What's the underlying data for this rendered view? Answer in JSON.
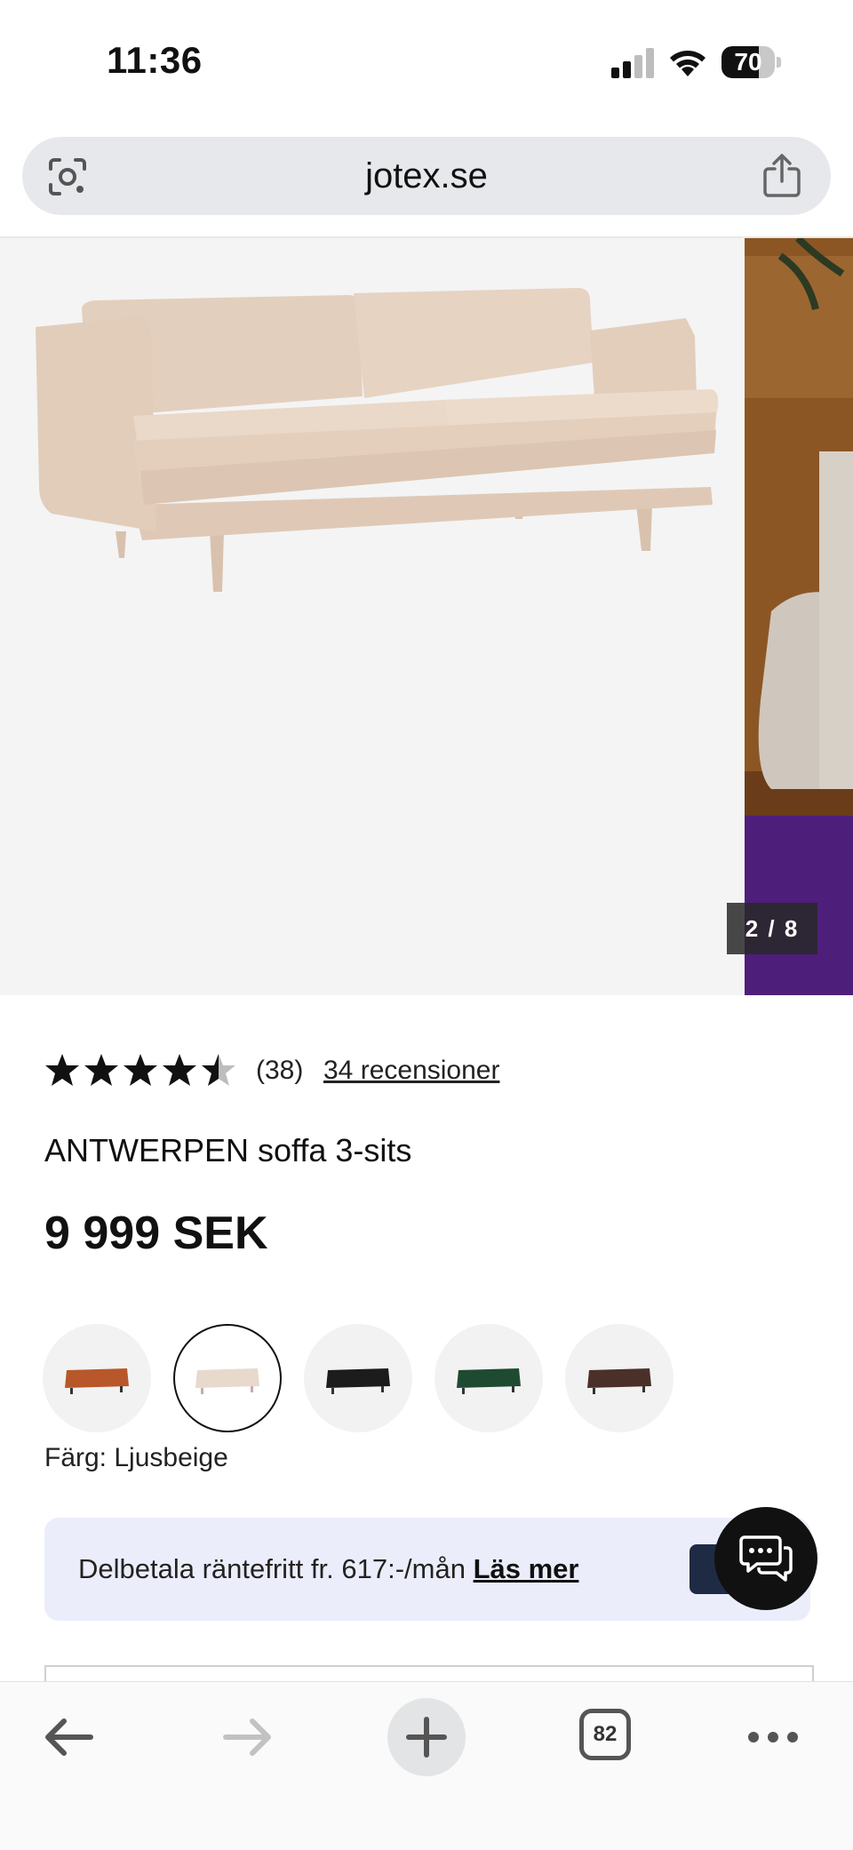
{
  "status_bar": {
    "time": "11:36",
    "battery": "70",
    "battery_level": 0.7,
    "icons": [
      "signal-icon",
      "wifi-icon",
      "battery-icon"
    ]
  },
  "address_bar": {
    "url": "jotex.se",
    "icons": [
      "lens-icon",
      "share-icon"
    ]
  },
  "gallery": {
    "counter": "2 / 8"
  },
  "product": {
    "rating_value": 4.5,
    "rating_count": "(38)",
    "reviews_link": "34 recensioner",
    "title": "ANTWERPEN soffa 3-sits",
    "price": "9 999 SEK",
    "color_label": "Färg: Ljusbeige",
    "swatch_colors": [
      "#b8572a",
      "#e7d9cc",
      "#1c1c1c",
      "#1e4a32",
      "#4a3028"
    ],
    "selected_swatch": 1
  },
  "installment": {
    "text": "Delbetala räntefritt fr. 617:-/mån ",
    "link": "Läs mer"
  },
  "toolbar": {
    "tabs_count": "82",
    "icons": [
      "back-icon",
      "forward-icon",
      "plus-icon",
      "tabs-icon",
      "more-icon"
    ]
  },
  "colors": {
    "address_bar_bg": "#e6e8eb",
    "banner_bg": "#ecedfb",
    "chat_button": "#111111"
  }
}
